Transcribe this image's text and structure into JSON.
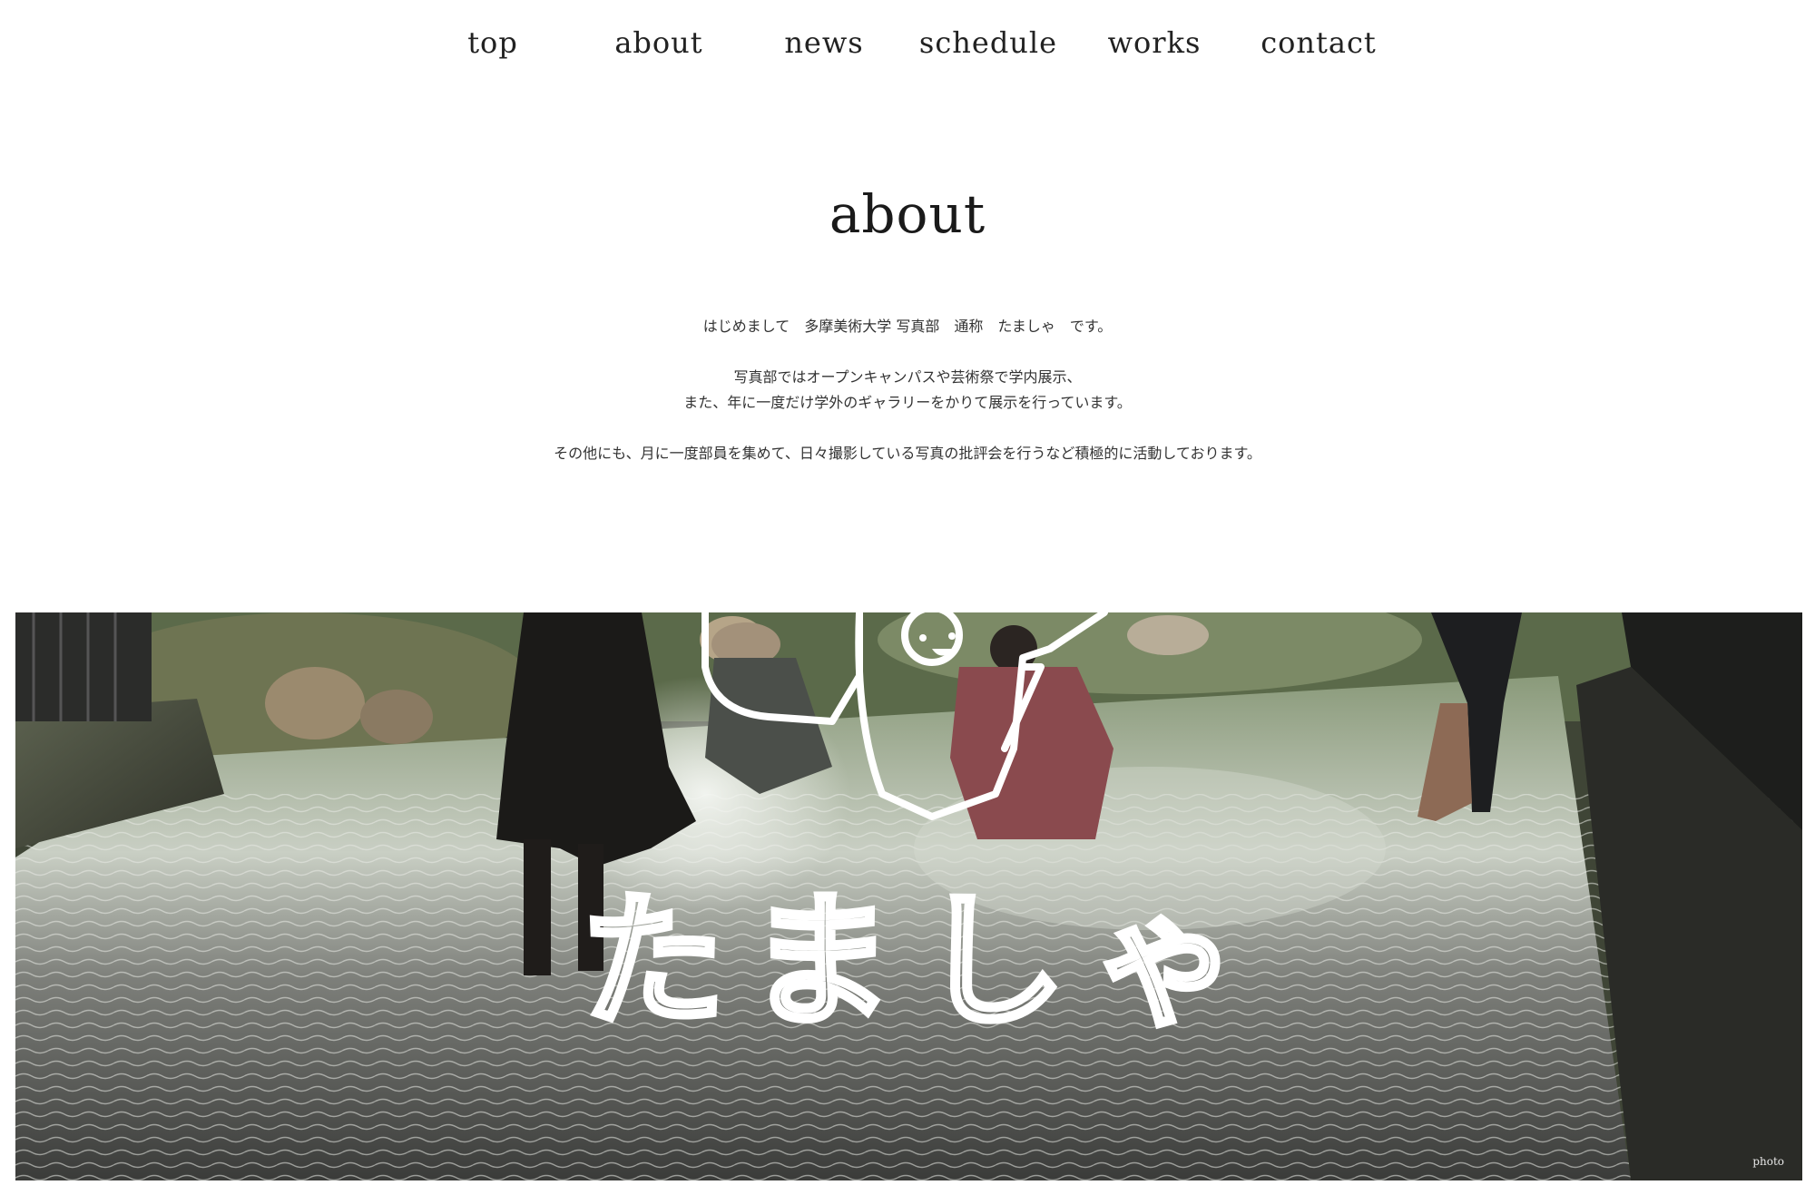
{
  "nav": {
    "items": [
      {
        "label": "top"
      },
      {
        "label": "about"
      },
      {
        "label": "news"
      },
      {
        "label": "schedule"
      },
      {
        "label": "works"
      },
      {
        "label": "contact"
      }
    ]
  },
  "main": {
    "title": "about",
    "paragraphs": [
      "はじめまして　多摩美術大学 写真部　通称　たましゃ　です。",
      "写真部ではオープンキャンパスや芸術祭で学内展示、",
      "また、年に一度だけ学外のギャラリーをかりて展示を行っています。",
      "その他にも、月に一度部員を集めて、日々撮影している写真の批評会を行うなど積極的に活動しております。"
    ]
  },
  "hero": {
    "logo_text": "たましゃ",
    "caption": "photo"
  }
}
